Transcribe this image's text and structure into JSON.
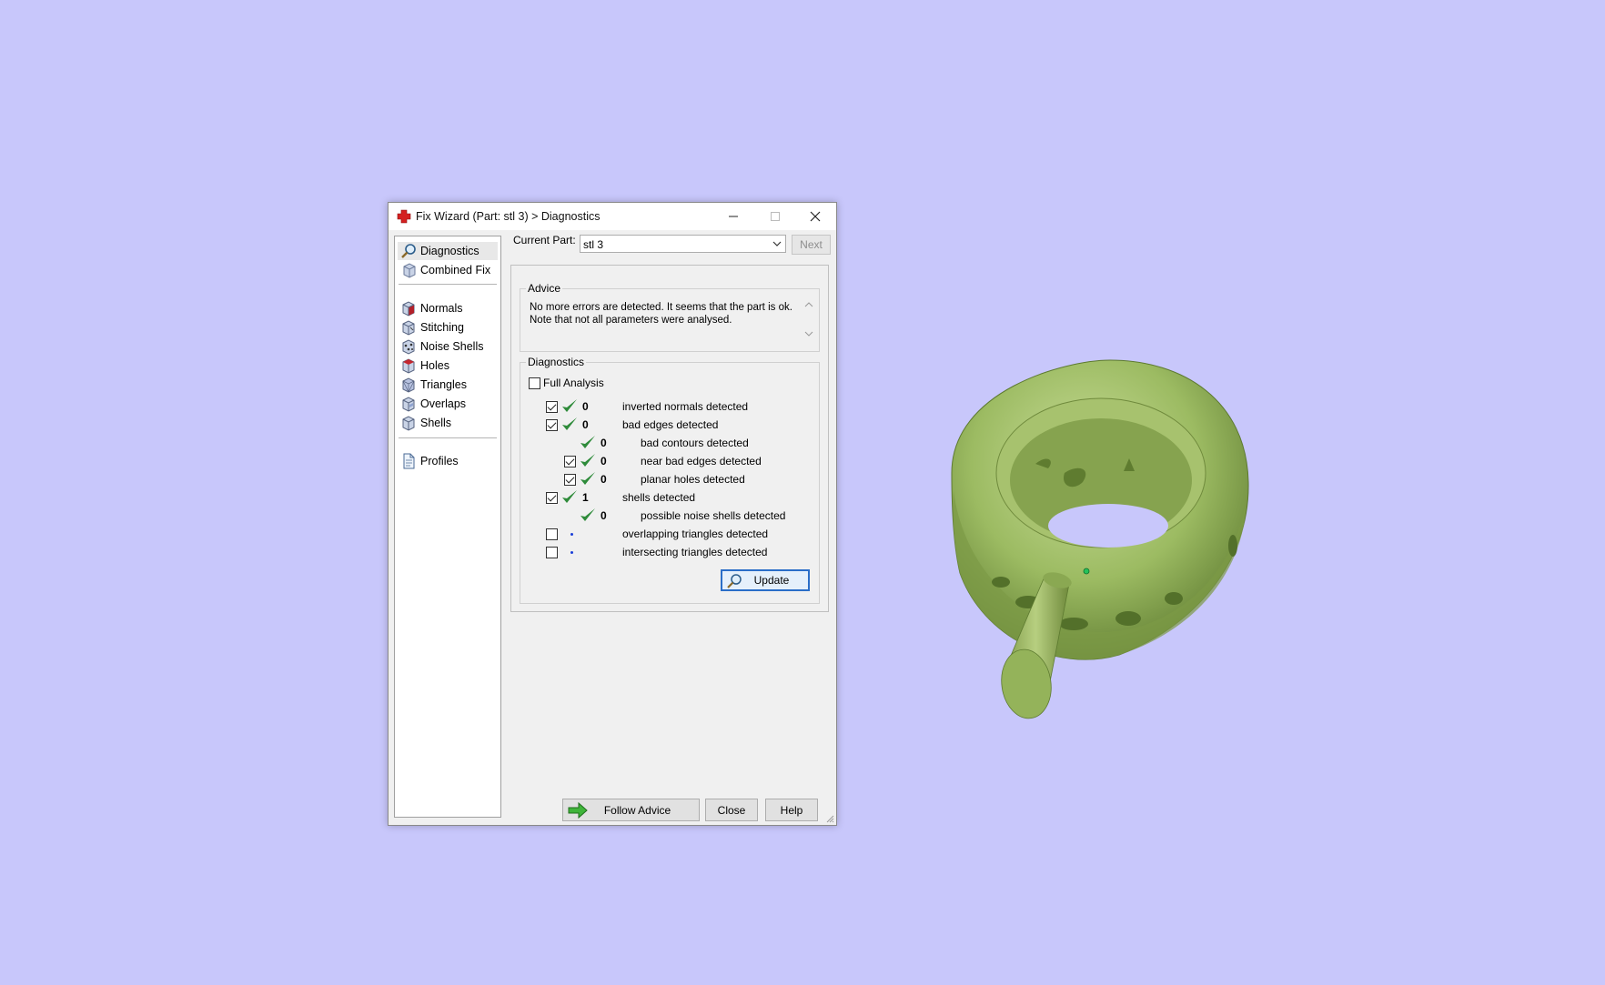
{
  "window": {
    "title": "Fix Wizard (Part: stl 3) > Diagnostics",
    "controls": {
      "minimize": "minimize",
      "maximize": "maximize",
      "close": "close"
    }
  },
  "nav": {
    "top_items": [
      {
        "label": "Diagnostics",
        "icon": "magnifier-icon",
        "selected": true
      },
      {
        "label": "Combined Fix",
        "icon": "cube-icon"
      }
    ],
    "fix_items": [
      {
        "label": "Normals",
        "icon": "normals-cube-icon"
      },
      {
        "label": "Stitching",
        "icon": "stitching-cube-icon"
      },
      {
        "label": "Noise Shells",
        "icon": "noise-shells-icon"
      },
      {
        "label": "Holes",
        "icon": "holes-cube-icon"
      },
      {
        "label": "Triangles",
        "icon": "triangles-cube-icon"
      },
      {
        "label": "Overlaps",
        "icon": "overlaps-cube-icon"
      },
      {
        "label": "Shells",
        "icon": "shells-cube-icon"
      }
    ],
    "bottom_items": [
      {
        "label": "Profiles",
        "icon": "profiles-document-icon"
      }
    ]
  },
  "current_part": {
    "label": "Current Part:",
    "value": "stl 3",
    "next_label": "Next"
  },
  "advice": {
    "title": "Advice",
    "line1": "No more errors are detected. It seems that the part is ok.",
    "line2": "Note that not all parameters were analysed."
  },
  "diagnostics": {
    "title": "Diagnostics",
    "full_analysis_label": "Full Analysis",
    "full_analysis_checked": false,
    "rows": [
      {
        "checkbox": true,
        "checked": true,
        "status": "ok",
        "count": "0",
        "label": "inverted normals detected",
        "indent": 0
      },
      {
        "checkbox": true,
        "checked": true,
        "status": "ok",
        "count": "0",
        "label": "bad edges detected",
        "indent": 0
      },
      {
        "checkbox": false,
        "checked": false,
        "status": "ok",
        "count": "0",
        "label": "bad contours detected",
        "indent": 1
      },
      {
        "checkbox": true,
        "checked": true,
        "status": "ok",
        "count": "0",
        "label": "near bad edges detected",
        "indent": 1
      },
      {
        "checkbox": true,
        "checked": true,
        "status": "ok",
        "count": "0",
        "label": "planar holes detected",
        "indent": 1
      },
      {
        "checkbox": true,
        "checked": true,
        "status": "ok",
        "count": "1",
        "label": "shells detected",
        "indent": 0
      },
      {
        "checkbox": false,
        "checked": false,
        "status": "ok",
        "count": "0",
        "label": "possible noise shells detected",
        "indent": 1
      },
      {
        "checkbox": true,
        "checked": false,
        "status": "pending",
        "count": "",
        "label": "overlapping triangles detected",
        "indent": 0
      },
      {
        "checkbox": true,
        "checked": false,
        "status": "pending",
        "count": "",
        "label": "intersecting triangles detected",
        "indent": 0
      }
    ],
    "update_label": "Update"
  },
  "footer": {
    "follow_advice_label": "Follow Advice",
    "close_label": "Close",
    "help_label": "Help"
  },
  "colors": {
    "desktop": "#c8c7fb",
    "model": "#9cbb62",
    "ok_tick": "#2e8b3a",
    "pending_dot": "#1a3fd8",
    "accent_focus": "#2a6ec8"
  }
}
